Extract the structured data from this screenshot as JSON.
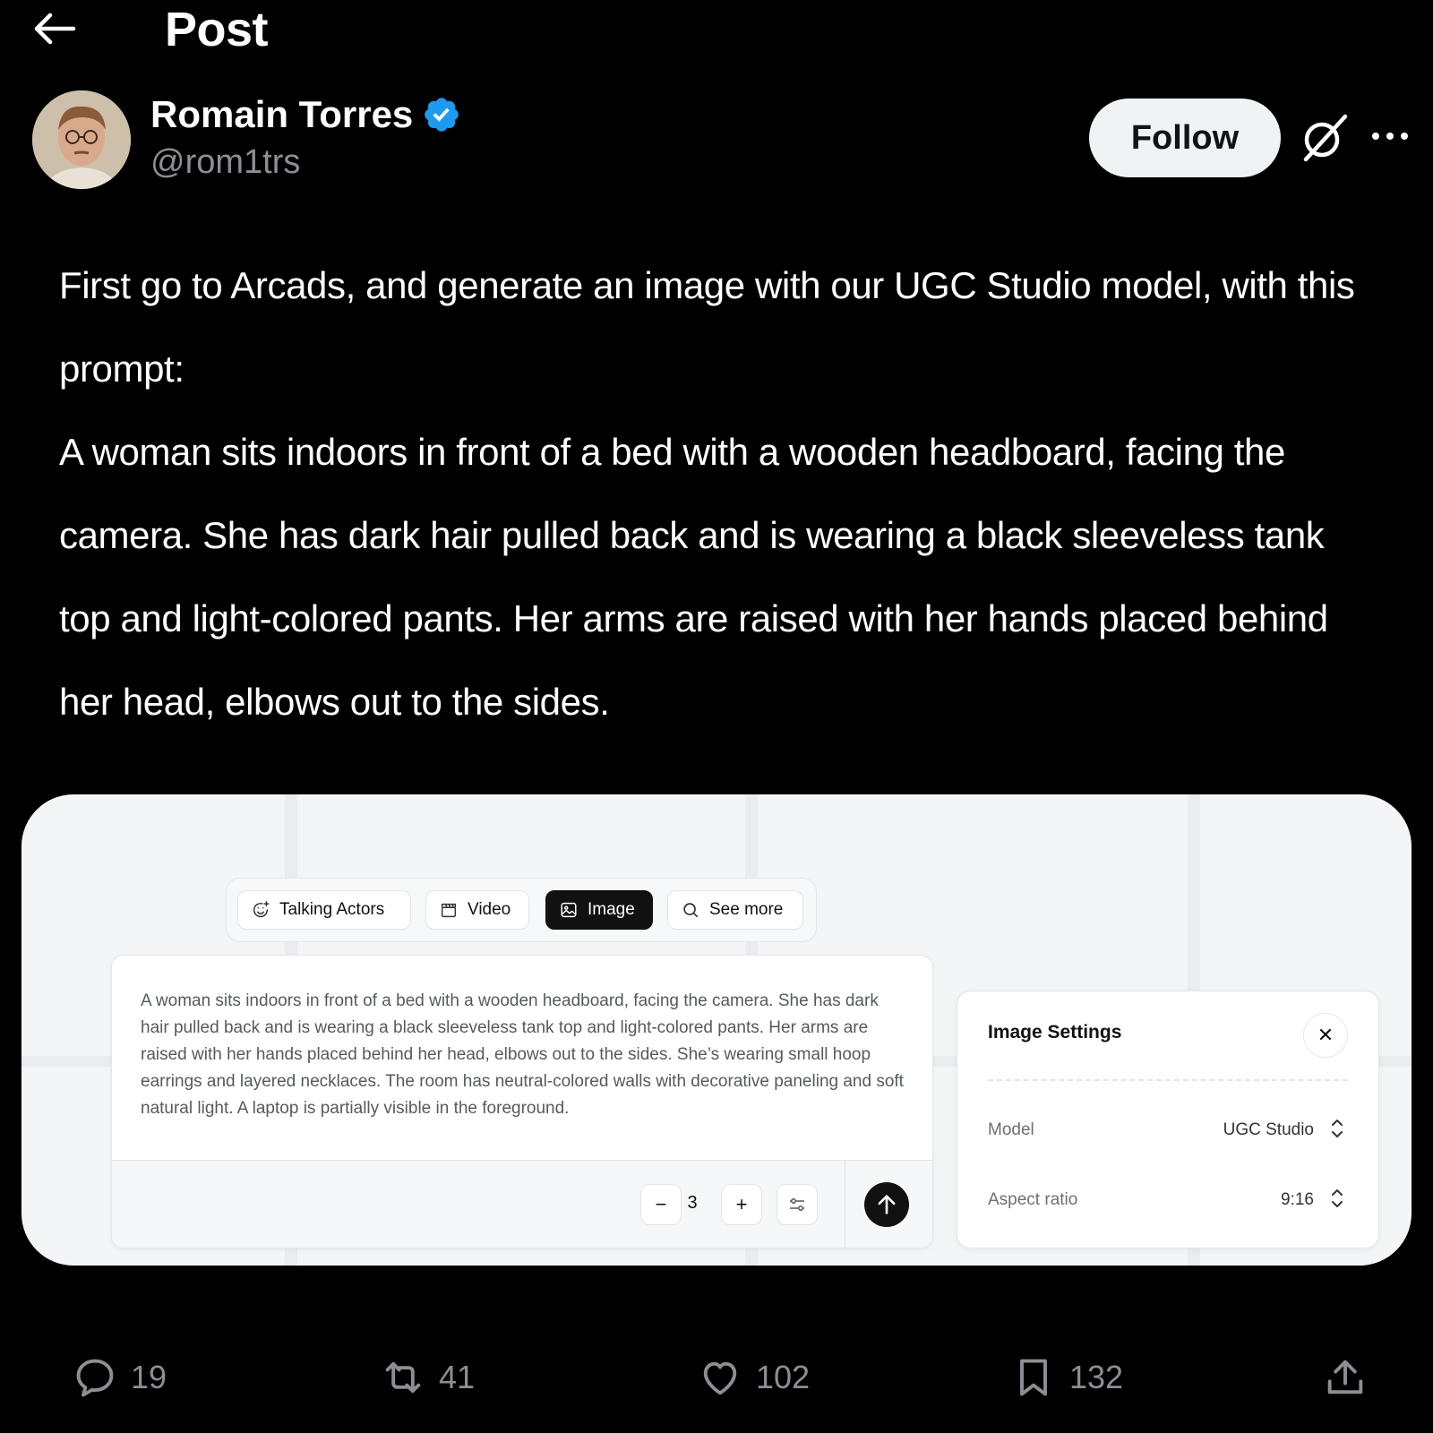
{
  "header": {
    "title": "Post"
  },
  "author": {
    "name": "Romain Torres",
    "handle": "@rom1trs"
  },
  "buttons": {
    "follow": "Follow"
  },
  "post": {
    "paragraphs": [
      "First go to Arcads, and generate an image with our UGC Studio model, with this prompt:",
      "A woman sits indoors in front of a bed with a wooden headboard, facing the camera. She has dark hair pulled back and is wearing a black sleeveless tank top and light-colored pants. Her arms are raised with her hands placed behind her head, elbows out to the sides."
    ]
  },
  "embed": {
    "tabs": [
      {
        "label": "Talking Actors",
        "icon": "smile-plus-icon"
      },
      {
        "label": "Video",
        "icon": "clapperboard-icon"
      },
      {
        "label": "Image",
        "icon": "image-icon",
        "active": true
      },
      {
        "label": "See more",
        "icon": "search-icon"
      }
    ],
    "prompt_text": "A woman sits indoors in front of a bed with a wooden headboard, facing the camera. She has dark hair pulled back and is wearing a black sleeveless tank top and light-colored pants. Her arms are raised with her hands placed behind her head, elbows out to the sides. She’s wearing small hoop earrings and layered necklaces. The room has neutral-colored walls with decorative paneling and soft natural light. A laptop is partially visible in the foreground.",
    "count": "3",
    "minus": "−",
    "plus": "+",
    "settings": {
      "title": "Image Settings",
      "close": "✕",
      "rows": [
        {
          "label": "Model",
          "value": "UGC Studio"
        },
        {
          "label": "Aspect ratio",
          "value": "9:16"
        }
      ]
    }
  },
  "metrics": {
    "replies": "19",
    "reposts": "41",
    "likes": "102",
    "bookmarks": "132"
  },
  "colors": {
    "background": "#000000",
    "verified": "#1d9bf0",
    "muted": "#8b8f94",
    "card": "#f4f5f7"
  }
}
